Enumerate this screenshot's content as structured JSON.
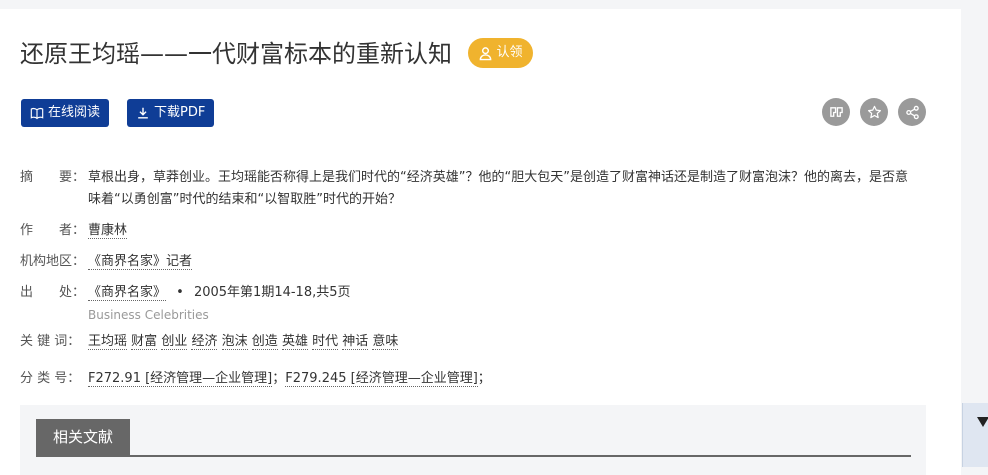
{
  "title": "还原王均瑶——一代财富标本的重新认知",
  "claim_label": "认领",
  "buttons": {
    "read_online": "在线阅读",
    "download_pdf": "下载PDF"
  },
  "icons": {
    "cite": "quote-icon",
    "favorite": "star-icon",
    "share": "share-icon"
  },
  "abstract": {
    "label": "摘　　要：",
    "text": "草根出身，草莽创业。王均瑶能否称得上是我们时代的“经济英雄”？他的“胆大包天”是创造了财富神话还是制造了财富泡沫？他的离去，是否意味着“以勇创富”时代的结束和“以智取胜”时代的开始？"
  },
  "author": {
    "label": "作　　者：",
    "value": "曹康林"
  },
  "org": {
    "label": "机构地区：",
    "value": "《商界名家》记者"
  },
  "source": {
    "label": "出　　处：",
    "journal": "《商界名家》",
    "sep": "•",
    "issue": "2005年第1期14-18,共5页",
    "journal_en": "Business Celebrities"
  },
  "keywords": {
    "label": "关 键 词：",
    "items": [
      "王均瑶",
      "财富",
      "创业",
      "经济",
      "泡沫",
      "创造",
      "英雄",
      "时代",
      "神话",
      "意味"
    ]
  },
  "classification": {
    "label": "分 类 号：",
    "items": [
      "F272.91 [经济管理—企业管理]",
      "F279.245 [经济管理—企业管理]"
    ],
    "sep": "；"
  },
  "related_tab": "相关文献",
  "colors": {
    "primary": "#0f3d96",
    "claim": "#f0b32e",
    "icon_circle": "#9a9a9a"
  }
}
